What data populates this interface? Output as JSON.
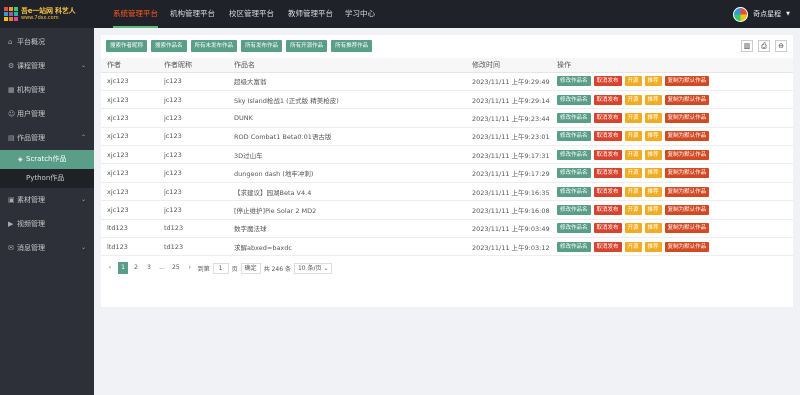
{
  "header": {
    "logo_text": "吾e一站网 科艺人",
    "logo_sub": "www.7dsx.com",
    "nav": [
      "系统管理平台",
      "机构管理平台",
      "校区管理平台",
      "教师管理平台",
      "学习中心"
    ],
    "active_nav": "系统管理平台",
    "user_name": "奇点星程"
  },
  "sidebar": {
    "items": [
      {
        "icon": "home-icon",
        "label": "平台概况"
      },
      {
        "icon": "settings-icon",
        "label": "课程管理"
      },
      {
        "icon": "building-icon",
        "label": "机构管理"
      },
      {
        "icon": "user-icon",
        "label": "用户管理"
      },
      {
        "icon": "folder-icon",
        "label": "作品管理"
      },
      {
        "icon": "image-icon",
        "label": "素材管理"
      },
      {
        "icon": "video-icon",
        "label": "视频管理"
      },
      {
        "icon": "message-icon",
        "label": "消息管理"
      }
    ],
    "sub_items": [
      "Scratch作品",
      "Python作品"
    ],
    "active_sub": "Scratch作品"
  },
  "toolbar": {
    "buttons": [
      "搜索作者昵称",
      "搜索作品名",
      "所有未发布作品",
      "所有发布作品",
      "所有开源作品",
      "所有推荐作品"
    ]
  },
  "table": {
    "headers": [
      "作者",
      "作者昵称",
      "作品名",
      "修改时间",
      "操作"
    ],
    "rows": [
      [
        "xjc123",
        "jc123",
        "超级大富翁",
        "2023/11/11 上午9:29:49"
      ],
      [
        "xjc123",
        "jc123",
        "Sky Island枪战1 (正式版 精美枪皮)",
        "2023/11/11 上午9:29:14"
      ],
      [
        "xjc123",
        "jc123",
        "DUNK",
        "2023/11/11 上午9:23:44"
      ],
      [
        "xjc123",
        "jc123",
        "ROD Combat1 Beta0.01语古版",
        "2023/11/11 上午9:23:01"
      ],
      [
        "xjc123",
        "jc123",
        "3D过山车",
        "2023/11/11 上午9:17:31"
      ],
      [
        "xjc123",
        "jc123",
        "dungeon dash (地牢冲刺)",
        "2023/11/11 上午9:17:29"
      ],
      [
        "xjc123",
        "jc123",
        "【求建议】园湖Beta V4.4",
        "2023/11/11 上午9:16:35"
      ],
      [
        "xjc123",
        "jc123",
        "[停止维护]Pie Solar 2 MD2",
        "2023/11/11 上午9:16:08"
      ],
      [
        "ltd123",
        "td123",
        "数字魔法球",
        "2023/11/11 上午9:03:49"
      ],
      [
        "ltd123",
        "td123",
        "求解abxed=baxdc",
        "2023/11/11 上午9:03:12"
      ]
    ],
    "ops": [
      {
        "label": "修改作品名",
        "color": "#5a9e88"
      },
      {
        "label": "取消发布",
        "color": "#d7432d"
      },
      {
        "label": "开源",
        "color": "#f0ad24"
      },
      {
        "label": "推荐",
        "color": "#f0ad24"
      },
      {
        "label": "复制为默认作品",
        "color": "#d24a24"
      }
    ]
  },
  "pager": {
    "prev": "‹",
    "pages": [
      "1",
      "2",
      "3",
      "...",
      "25"
    ],
    "next": "›",
    "goto_label": "到第",
    "goto_value": "1",
    "page_unit": "页",
    "confirm": "确定",
    "total": "共 246 条",
    "page_size": "10 条/页"
  }
}
